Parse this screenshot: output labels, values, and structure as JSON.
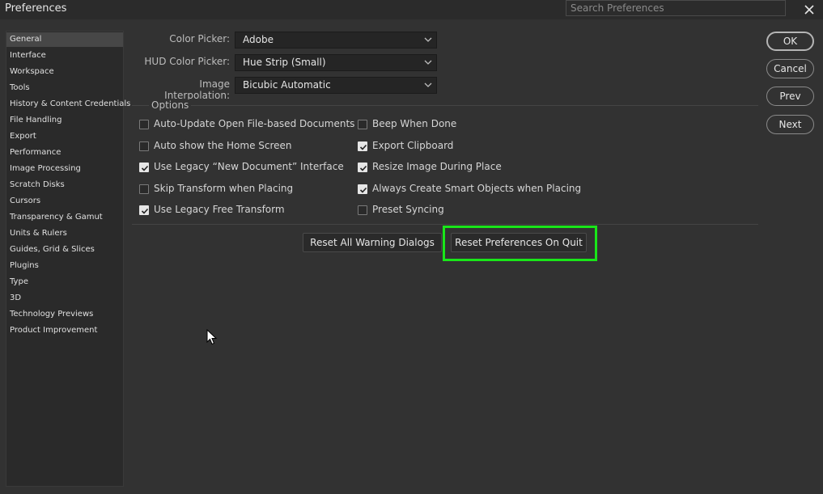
{
  "window": {
    "title": "Preferences"
  },
  "search": {
    "placeholder": "Search Preferences"
  },
  "sidebar": {
    "items": [
      {
        "label": "General",
        "selected": true
      },
      {
        "label": "Interface"
      },
      {
        "label": "Workspace"
      },
      {
        "label": "Tools"
      },
      {
        "label": "History & Content Credentials"
      },
      {
        "label": "File Handling"
      },
      {
        "label": "Export"
      },
      {
        "label": "Performance"
      },
      {
        "label": "Image Processing"
      },
      {
        "label": "Scratch Disks"
      },
      {
        "label": "Cursors"
      },
      {
        "label": "Transparency & Gamut"
      },
      {
        "label": "Units & Rulers"
      },
      {
        "label": "Guides, Grid & Slices"
      },
      {
        "label": "Plugins"
      },
      {
        "label": "Type"
      },
      {
        "label": "3D"
      },
      {
        "label": "Technology Previews"
      },
      {
        "label": "Product Improvement"
      }
    ]
  },
  "fields": {
    "color_picker": {
      "label": "Color Picker:",
      "value": "Adobe"
    },
    "hud_color_picker": {
      "label": "HUD Color Picker:",
      "value": "Hue Strip (Small)"
    },
    "image_interpolation": {
      "label": "Image Interpolation:",
      "value": "Bicubic Automatic"
    }
  },
  "options": {
    "title": "Options",
    "left": [
      {
        "label": "Auto-Update Open File-based Documents",
        "checked": false
      },
      {
        "label": "Auto show the Home Screen",
        "checked": false
      },
      {
        "label": "Use Legacy “New Document” Interface",
        "checked": true
      },
      {
        "label": "Skip Transform when Placing",
        "checked": false
      },
      {
        "label": "Use Legacy Free Transform",
        "checked": true
      }
    ],
    "right": [
      {
        "label": "Beep When Done",
        "checked": false
      },
      {
        "label": "Export Clipboard",
        "checked": true
      },
      {
        "label": "Resize Image During Place",
        "checked": true
      },
      {
        "label": "Always Create Smart Objects when Placing",
        "checked": true
      },
      {
        "label": "Preset Syncing",
        "checked": false
      }
    ]
  },
  "actions": {
    "reset_warnings": "Reset All Warning Dialogs",
    "reset_prefs": "Reset Preferences On Quit"
  },
  "dialog_buttons": {
    "ok": "OK",
    "cancel": "Cancel",
    "prev": "Prev",
    "next": "Next"
  },
  "colors": {
    "highlight": "#19e619",
    "background": "#323232",
    "sidebar_selected": "#474747"
  }
}
